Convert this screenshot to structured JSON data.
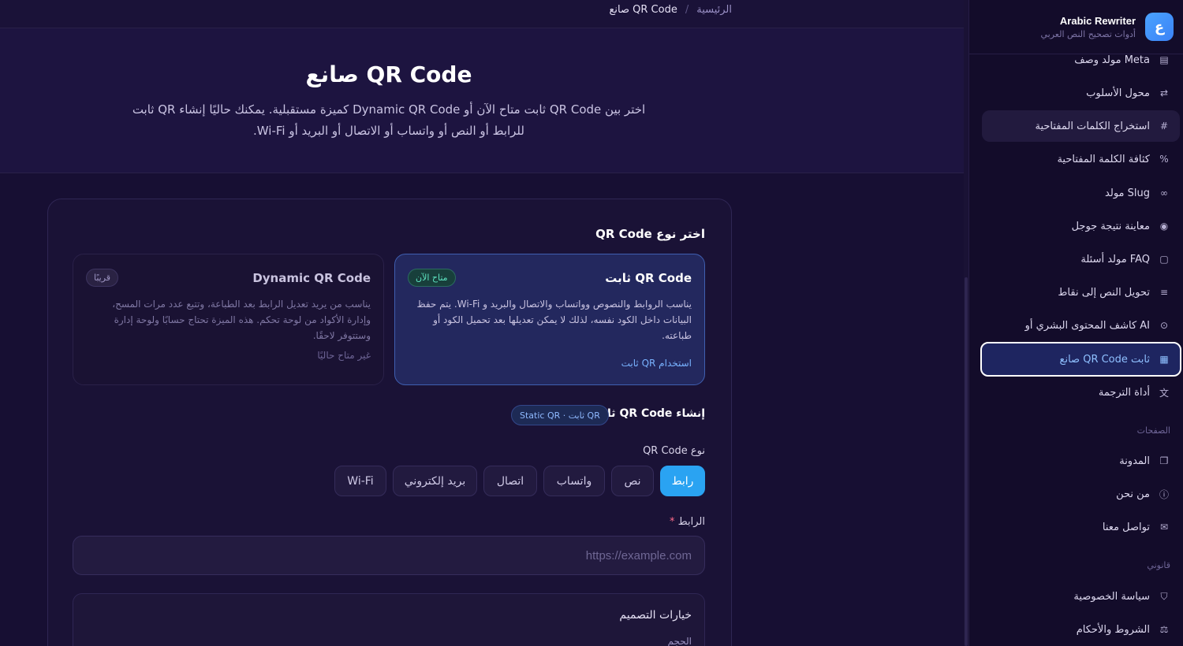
{
  "breadcrumb": {
    "home": "الرئيسية",
    "separator": "/",
    "current": "صانع QR Code"
  },
  "hero": {
    "title": "صانع QR Code",
    "description": "اختر بين QR Code ثابت متاح الآن أو Dynamic QR Code كميزة مستقبلية. يمكنك حاليًا إنشاء QR ثابت للرابط أو النص أو واتساب أو الاتصال أو البريد أو Wi-Fi."
  },
  "brand": {
    "name": "Arabic Rewriter",
    "subtitle": "أدوات تصحيح النص العربي",
    "logo": "ع"
  },
  "sidebar": {
    "items": [
      {
        "label": "مولد وصف Meta",
        "icon": "document-icon"
      },
      {
        "label": "محول الأسلوب",
        "icon": "repeat-icon"
      },
      {
        "label": "استخراج الكلمات المفتاحية",
        "icon": "hash-icon"
      },
      {
        "label": "كثافة الكلمة المفتاحية",
        "icon": "percent-icon"
      },
      {
        "label": "مولد Slug",
        "icon": "link-icon"
      },
      {
        "label": "معاينة نتيجة جوجل",
        "icon": "eye-icon"
      },
      {
        "label": "مولد أسئلة FAQ",
        "icon": "message-icon"
      },
      {
        "label": "تحويل النص إلى نقاط",
        "icon": "list-icon"
      },
      {
        "label": "كاشف المحتوى البشري أو AI",
        "icon": "scan-icon"
      },
      {
        "label": "صانع QR Code ثابت",
        "icon": "qr-icon"
      },
      {
        "label": "أداة الترجمة",
        "icon": "translate-icon"
      }
    ],
    "pages_section": "الصفحات",
    "pages": [
      {
        "label": "المدونة",
        "icon": "book-icon"
      },
      {
        "label": "من نحن",
        "icon": "info-icon"
      },
      {
        "label": "تواصل معنا",
        "icon": "mail-icon"
      }
    ],
    "legal_section": "قانوني",
    "legal": [
      {
        "label": "سياسة الخصوصية",
        "icon": "shield-icon"
      },
      {
        "label": "الشروط والأحكام",
        "icon": "scale-icon"
      }
    ]
  },
  "card": {
    "choose_title": "اختر نوع QR Code",
    "static": {
      "title": "QR Code ثابت",
      "badge": "متاح الآن",
      "description": "يناسب الروابط والنصوص وواتساب والاتصال والبريد و Wi-Fi. يتم حفظ البيانات داخل الكود نفسه، لذلك لا يمكن تعديلها بعد تحميل الكود أو طباعته.",
      "link": "استخدام QR ثابت"
    },
    "dynamic": {
      "title": "Dynamic QR Code",
      "badge": "قريبًا",
      "description": "يناسب من يريد تعديل الرابط بعد الطباعة، وتتبع عدد مرات المسح، وإدارة الأكواد من لوحة تحكم. هذه الميزة تحتاج حسابًا ولوحة إدارة وستتوفر لاحقًا.",
      "link": "غير متاح حاليًا"
    },
    "create_title": "إنشاء QR Code ثابت",
    "create_badge": "QR ثابت · Static QR",
    "type_label": "نوع QR Code",
    "types": [
      "رابط",
      "نص",
      "واتساب",
      "اتصال",
      "بريد إلكتروني",
      "Wi-Fi"
    ],
    "active_type": "رابط",
    "url_label": "الرابط",
    "url_required": "*",
    "url_placeholder": "https://example.com",
    "url_value": "",
    "design_title": "خيارات التصميم",
    "size_label": "الحجم"
  },
  "colors": {
    "accent": "#2aa3f2",
    "background": "#170f33",
    "available": "#5ee3c0"
  }
}
